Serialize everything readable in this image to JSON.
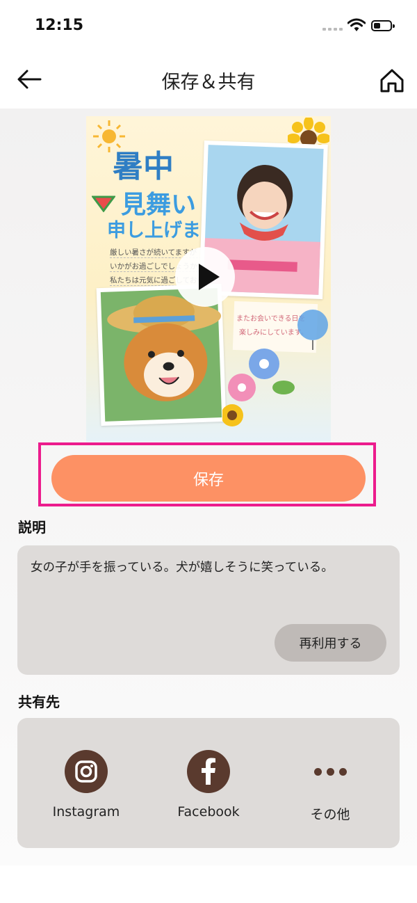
{
  "status_bar": {
    "time": "12:15"
  },
  "header": {
    "title": "保存＆共有"
  },
  "preview": {
    "title_line1": "暑中",
    "title_line2": "見舞い",
    "title_line3": "申し上げます",
    "message_lines": [
      "厳しい暑さが続いてますが",
      "いかがお過ごしでしょうか",
      "私たちは元気に過ごしております"
    ],
    "note_lines": [
      "またお会いできる日を",
      "楽しみにしています。"
    ]
  },
  "save_button": {
    "label": "保存"
  },
  "description": {
    "section_label": "説明",
    "text": "女の子が手を振っている。犬が嬉しそうに笑っている。",
    "reuse_label": "再利用する"
  },
  "share": {
    "section_label": "共有先",
    "items": [
      {
        "label": "Instagram",
        "icon": "instagram-icon"
      },
      {
        "label": "Facebook",
        "icon": "facebook-icon"
      },
      {
        "label": "その他",
        "icon": "more-icon"
      }
    ]
  },
  "colors": {
    "accent": "#fd9164",
    "highlight_frame": "#ec1c8d",
    "card_bg": "#dedbd9",
    "icon_brown": "#5a3a2e"
  }
}
